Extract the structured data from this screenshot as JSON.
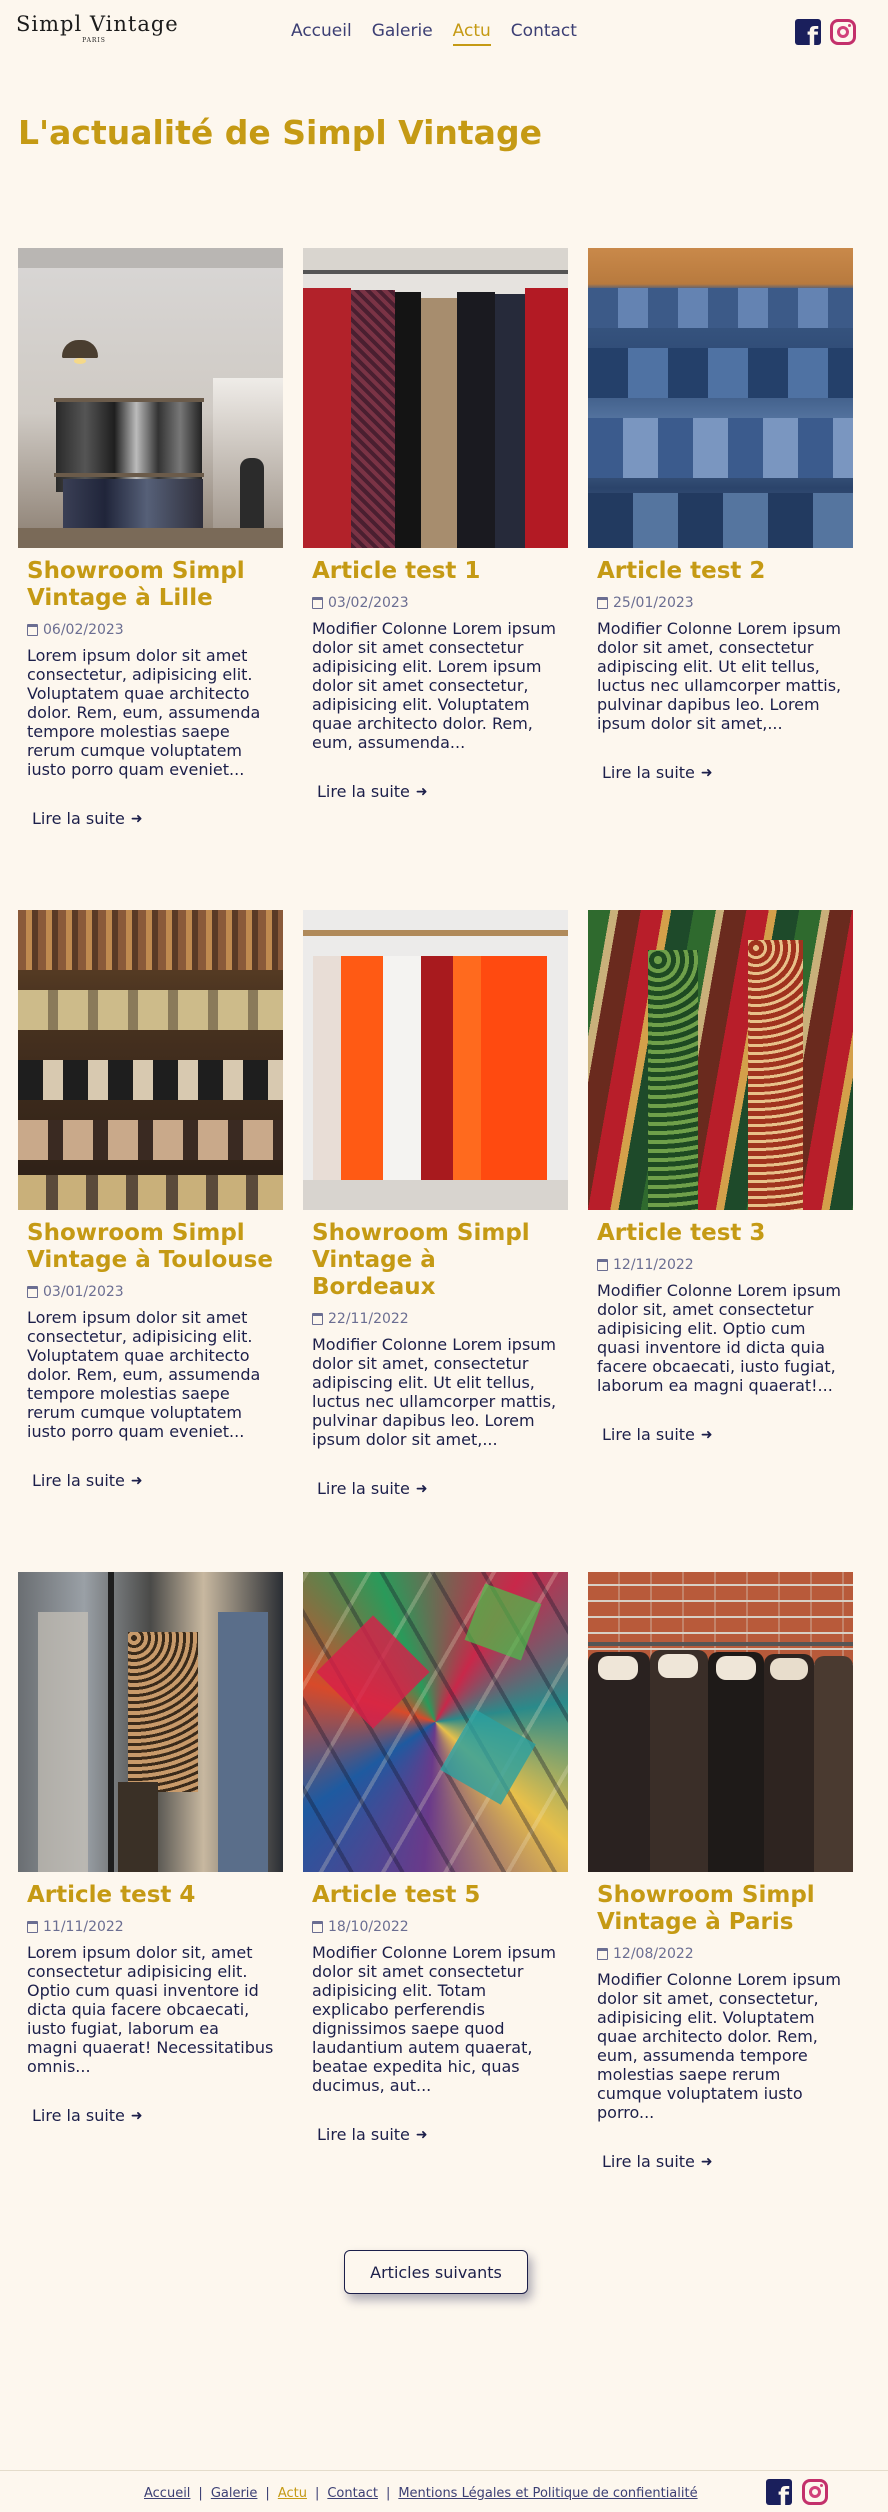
{
  "header": {
    "logo": {
      "name": "Simpl Vintage",
      "sub": "PARIS"
    },
    "nav": [
      {
        "label": "Accueil",
        "active": false
      },
      {
        "label": "Galerie",
        "active": false
      },
      {
        "label": "Actu",
        "active": true
      },
      {
        "label": "Contact",
        "active": false
      }
    ],
    "social": [
      "facebook-icon",
      "instagram-icon"
    ]
  },
  "page_title": "L'actualité de Simpl Vintage",
  "read_more_label": "Lire la suite",
  "articles": [
    {
      "title": "Showroom Simpl Vintage à Lille",
      "date": "06/02/2023",
      "image": "showroom-lille-photo",
      "excerpt": "Lorem ipsum dolor sit amet consectetur, adipisicing elit. Voluptatem quae architecto dolor. Rem, eum, assumenda tempore molestias saepe rerum cumque voluptatem iusto porro quam eveniet..."
    },
    {
      "title": "Article test 1",
      "date": "03/02/2023",
      "image": "coats-rack-photo",
      "excerpt": "Modifier Colonne Lorem ipsum dolor sit amet consectetur adipisicing elit. Lorem ipsum dolor sit amet consectetur, adipisicing elit. Voluptatem quae architecto dolor. Rem, eum, assumenda..."
    },
    {
      "title": "Article test 2",
      "date": "25/01/2023",
      "image": "jeans-stack-photo",
      "excerpt": "Modifier Colonne Lorem ipsum dolor sit amet, consectetur adipiscing elit. Ut elit tellus, luctus nec ullamcorper mattis, pulvinar dapibus leo. Lorem ipsum dolor sit amet,..."
    },
    {
      "title": "Showroom Simpl Vintage à Toulouse",
      "date": "03/01/2023",
      "image": "shoes-shelf-photo",
      "excerpt": "Lorem ipsum dolor sit amet consectetur, adipisicing elit. Voluptatem quae architecto dolor. Rem, eum, assumenda tempore molestias saepe rerum cumque voluptatem iusto porro quam eveniet..."
    },
    {
      "title": "Showroom Simpl Vintage à Bordeaux",
      "date": "22/11/2022",
      "image": "colorful-tops-photo",
      "excerpt": "Modifier Colonne Lorem ipsum dolor sit amet, consectetur adipiscing elit. Ut elit tellus, luctus nec ullamcorper mattis, pulvinar dapibus leo. Lorem ipsum dolor sit amet,..."
    },
    {
      "title": "Article test 3",
      "date": "12/11/2022",
      "image": "patterned-shirts-photo",
      "excerpt": "Modifier Colonne Lorem ipsum dolor sit, amet consectetur adipisicing elit. Optio cum quasi inventore id dicta quia facere obcaecati, iusto fugiat, laborum ea magni quaerat!..."
    },
    {
      "title": "Article test 4",
      "date": "11/11/2022",
      "image": "mannequin-window-photo",
      "excerpt": "Lorem ipsum dolor sit, amet consectetur adipisicing elit. Optio cum quasi inventore id dicta quia facere obcaecati, iusto fugiat, laborum ea magni quaerat! Necessitatibus omnis..."
    },
    {
      "title": "Article test 5",
      "date": "18/10/2022",
      "image": "patchwork-fabric-photo",
      "excerpt": "Modifier Colonne Lorem ipsum dolor sit amet consectetur adipisicing elit. Totam explicabo perferendis dignissimos saepe quod laudantium autem quaerat, beatae expedita hic, quas ducimus, aut..."
    },
    {
      "title": "Showroom Simpl Vintage à Paris",
      "date": "12/08/2022",
      "image": "leather-jackets-photo",
      "excerpt": "Modifier Colonne Lorem ipsum dolor sit amet, consectetur, adipisicing elit. Voluptatem quae architecto dolor. Rem, eum, assumenda tempore molestias saepe rerum cumque voluptatem iusto porro..."
    }
  ],
  "next_button": "Articles suivants",
  "footer": {
    "links": [
      {
        "label": "Accueil",
        "active": false
      },
      {
        "label": "Galerie",
        "active": false
      },
      {
        "label": "Actu",
        "active": true
      },
      {
        "label": "Contact",
        "active": false
      },
      {
        "label": "Mentions Légales et Politique de confientialité",
        "active": false
      }
    ],
    "separator": "|"
  },
  "colors": {
    "accent": "#c59a14",
    "text": "#1c1f4a",
    "background": "#fdf7ee"
  }
}
